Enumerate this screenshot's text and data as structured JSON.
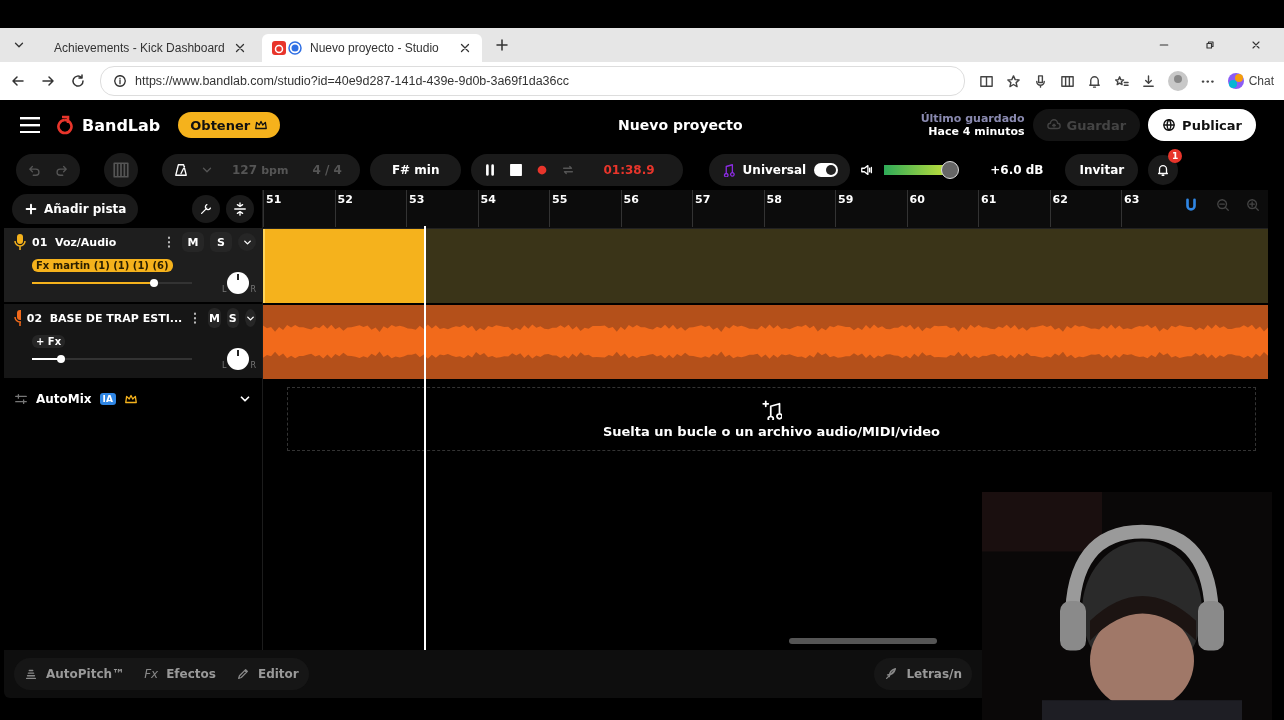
{
  "browser": {
    "tabs": [
      {
        "title": "Achievements - Kick Dashboard",
        "selected": false
      },
      {
        "title": "Nuevo proyecto - Studio",
        "selected": true
      }
    ],
    "url": "https://www.bandlab.com/studio?id=40e9d287-141d-439e-9d0b-3a69f1da36cc",
    "chat": "Chat"
  },
  "header": {
    "logo": "BandLab",
    "obtain": "Obtener",
    "title": "Nuevo proyecto",
    "last_saved_label": "Último guardado",
    "last_saved_time": "Hace 4 minutos",
    "save": "Guardar",
    "publish": "Publicar"
  },
  "toolbar": {
    "bpm": "127",
    "bpm_unit": "bpm",
    "time_sig": "4 / 4",
    "key": "F# min",
    "time": "01:38.9",
    "universal": "Universal",
    "universal_on": true,
    "master_volume": {
      "level": 0.82
    },
    "gain": "+6.0 dB",
    "invite": "Invitar",
    "notifications": "1"
  },
  "add_track": "Añadir pista",
  "ruler": [
    "51",
    "52",
    "53",
    "54",
    "55",
    "56",
    "57",
    "58",
    "59",
    "60",
    "61",
    "62",
    "63"
  ],
  "tracks": [
    {
      "number": "01",
      "name": "Voz/Audio",
      "fx": "Fx martin (1) (1) (1) (6)",
      "fx_applied": true,
      "selected": true,
      "volume": {
        "level": 0.76
      },
      "pan_left": "L",
      "pan_right": "R",
      "color": "#f5b21c",
      "mute": "M",
      "solo": "S",
      "kind": "clip"
    },
    {
      "number": "02",
      "name": "BASE DE TRAP ESTI...",
      "fx": "+ Fx",
      "fx_applied": false,
      "selected": false,
      "volume": {
        "level": 0.18
      },
      "pan_left": "L",
      "pan_right": "R",
      "color": "#f26a1b",
      "mute": "M",
      "solo": "S",
      "kind": "waveform"
    }
  ],
  "automix": {
    "label": "AutoMix",
    "badge": "IA"
  },
  "drop_zone": "Suelta un bucle o un archivo audio/MIDI/video",
  "bottom": [
    {
      "label": "AutoPitch™",
      "kind": "pitch"
    },
    {
      "label": "Efectos",
      "kind": "fx",
      "icon": "Fx"
    },
    {
      "label": "Editor",
      "kind": "pencil"
    }
  ],
  "lyrics": "Letras/n"
}
